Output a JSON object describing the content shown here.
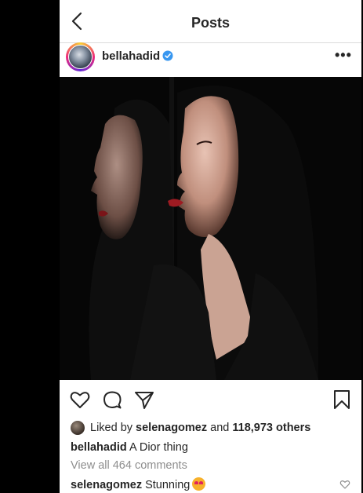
{
  "nav": {
    "title": "Posts",
    "back_icon": "chevron-left-icon"
  },
  "post": {
    "username": "bellahadid",
    "verified_color": "#3897f0",
    "more_label": "•••"
  },
  "actions": {
    "like_icon": "heart-icon",
    "comment_icon": "comment-icon",
    "share_icon": "send-icon",
    "save_icon": "bookmark-icon"
  },
  "likes": {
    "prefix": "Liked by ",
    "user": "selenagomez",
    "middle": " and ",
    "count": "118,973 others"
  },
  "caption": {
    "user": "bellahadid",
    "text": " A Dior thing"
  },
  "comments": {
    "view_all": "View all 464 comments"
  },
  "comment": {
    "user": "selenagomez",
    "text": " Stunning",
    "emoji": "heart-eyes-emoji"
  }
}
